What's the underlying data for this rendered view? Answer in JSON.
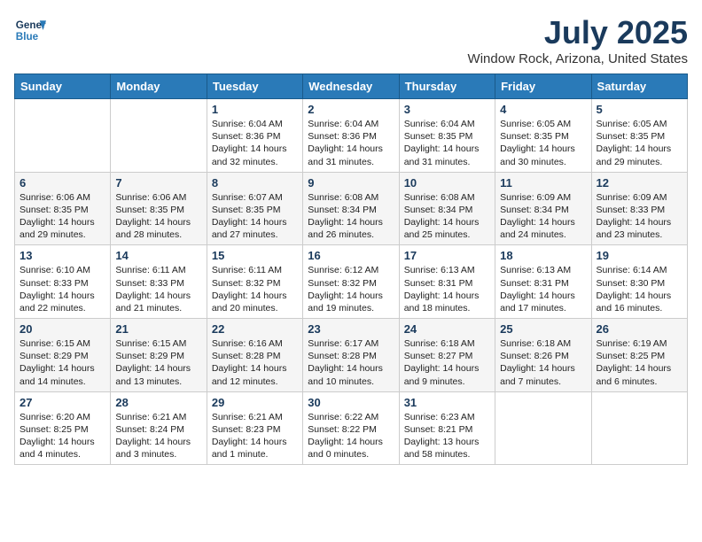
{
  "header": {
    "logo_line1": "General",
    "logo_line2": "Blue",
    "title": "July 2025",
    "subtitle": "Window Rock, Arizona, United States"
  },
  "days_of_week": [
    "Sunday",
    "Monday",
    "Tuesday",
    "Wednesday",
    "Thursday",
    "Friday",
    "Saturday"
  ],
  "weeks": [
    [
      {
        "day": "",
        "info": ""
      },
      {
        "day": "",
        "info": ""
      },
      {
        "day": "1",
        "info": "Sunrise: 6:04 AM\nSunset: 8:36 PM\nDaylight: 14 hours and 32 minutes."
      },
      {
        "day": "2",
        "info": "Sunrise: 6:04 AM\nSunset: 8:36 PM\nDaylight: 14 hours and 31 minutes."
      },
      {
        "day": "3",
        "info": "Sunrise: 6:04 AM\nSunset: 8:35 PM\nDaylight: 14 hours and 31 minutes."
      },
      {
        "day": "4",
        "info": "Sunrise: 6:05 AM\nSunset: 8:35 PM\nDaylight: 14 hours and 30 minutes."
      },
      {
        "day": "5",
        "info": "Sunrise: 6:05 AM\nSunset: 8:35 PM\nDaylight: 14 hours and 29 minutes."
      }
    ],
    [
      {
        "day": "6",
        "info": "Sunrise: 6:06 AM\nSunset: 8:35 PM\nDaylight: 14 hours and 29 minutes."
      },
      {
        "day": "7",
        "info": "Sunrise: 6:06 AM\nSunset: 8:35 PM\nDaylight: 14 hours and 28 minutes."
      },
      {
        "day": "8",
        "info": "Sunrise: 6:07 AM\nSunset: 8:35 PM\nDaylight: 14 hours and 27 minutes."
      },
      {
        "day": "9",
        "info": "Sunrise: 6:08 AM\nSunset: 8:34 PM\nDaylight: 14 hours and 26 minutes."
      },
      {
        "day": "10",
        "info": "Sunrise: 6:08 AM\nSunset: 8:34 PM\nDaylight: 14 hours and 25 minutes."
      },
      {
        "day": "11",
        "info": "Sunrise: 6:09 AM\nSunset: 8:34 PM\nDaylight: 14 hours and 24 minutes."
      },
      {
        "day": "12",
        "info": "Sunrise: 6:09 AM\nSunset: 8:33 PM\nDaylight: 14 hours and 23 minutes."
      }
    ],
    [
      {
        "day": "13",
        "info": "Sunrise: 6:10 AM\nSunset: 8:33 PM\nDaylight: 14 hours and 22 minutes."
      },
      {
        "day": "14",
        "info": "Sunrise: 6:11 AM\nSunset: 8:33 PM\nDaylight: 14 hours and 21 minutes."
      },
      {
        "day": "15",
        "info": "Sunrise: 6:11 AM\nSunset: 8:32 PM\nDaylight: 14 hours and 20 minutes."
      },
      {
        "day": "16",
        "info": "Sunrise: 6:12 AM\nSunset: 8:32 PM\nDaylight: 14 hours and 19 minutes."
      },
      {
        "day": "17",
        "info": "Sunrise: 6:13 AM\nSunset: 8:31 PM\nDaylight: 14 hours and 18 minutes."
      },
      {
        "day": "18",
        "info": "Sunrise: 6:13 AM\nSunset: 8:31 PM\nDaylight: 14 hours and 17 minutes."
      },
      {
        "day": "19",
        "info": "Sunrise: 6:14 AM\nSunset: 8:30 PM\nDaylight: 14 hours and 16 minutes."
      }
    ],
    [
      {
        "day": "20",
        "info": "Sunrise: 6:15 AM\nSunset: 8:29 PM\nDaylight: 14 hours and 14 minutes."
      },
      {
        "day": "21",
        "info": "Sunrise: 6:15 AM\nSunset: 8:29 PM\nDaylight: 14 hours and 13 minutes."
      },
      {
        "day": "22",
        "info": "Sunrise: 6:16 AM\nSunset: 8:28 PM\nDaylight: 14 hours and 12 minutes."
      },
      {
        "day": "23",
        "info": "Sunrise: 6:17 AM\nSunset: 8:28 PM\nDaylight: 14 hours and 10 minutes."
      },
      {
        "day": "24",
        "info": "Sunrise: 6:18 AM\nSunset: 8:27 PM\nDaylight: 14 hours and 9 minutes."
      },
      {
        "day": "25",
        "info": "Sunrise: 6:18 AM\nSunset: 8:26 PM\nDaylight: 14 hours and 7 minutes."
      },
      {
        "day": "26",
        "info": "Sunrise: 6:19 AM\nSunset: 8:25 PM\nDaylight: 14 hours and 6 minutes."
      }
    ],
    [
      {
        "day": "27",
        "info": "Sunrise: 6:20 AM\nSunset: 8:25 PM\nDaylight: 14 hours and 4 minutes."
      },
      {
        "day": "28",
        "info": "Sunrise: 6:21 AM\nSunset: 8:24 PM\nDaylight: 14 hours and 3 minutes."
      },
      {
        "day": "29",
        "info": "Sunrise: 6:21 AM\nSunset: 8:23 PM\nDaylight: 14 hours and 1 minute."
      },
      {
        "day": "30",
        "info": "Sunrise: 6:22 AM\nSunset: 8:22 PM\nDaylight: 14 hours and 0 minutes."
      },
      {
        "day": "31",
        "info": "Sunrise: 6:23 AM\nSunset: 8:21 PM\nDaylight: 13 hours and 58 minutes."
      },
      {
        "day": "",
        "info": ""
      },
      {
        "day": "",
        "info": ""
      }
    ]
  ]
}
